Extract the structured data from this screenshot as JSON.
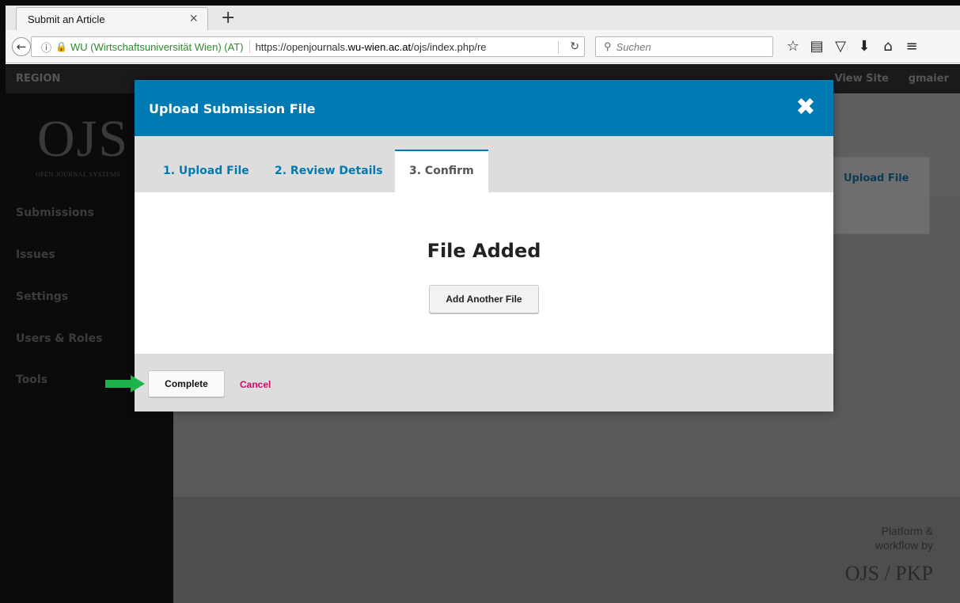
{
  "browser": {
    "tab_title": "Submit an Article",
    "tab_close": "×",
    "new_tab": "+",
    "url_info_icon": "info-icon",
    "url_org": "WU (Wirtschaftsuniversität Wien) (AT)",
    "url_prefix": "https://openjournals.",
    "url_domain": "wu-wien.ac.at",
    "url_suffix": "/ojs/index.php/re",
    "search_placeholder": "Suchen"
  },
  "page": {
    "header_left": "REGION",
    "header_site": "View Site",
    "header_user": "gmaier",
    "logo": "OJS",
    "logo_sub": "OPEN JOURNAL SYSTEMS",
    "sidebar": [
      {
        "label": "Submissions"
      },
      {
        "label": "Issues"
      },
      {
        "label": "Settings"
      },
      {
        "label": "Users & Roles"
      },
      {
        "label": "Tools"
      }
    ],
    "bg_upload_link": "Upload File",
    "footer_line1": "Platform &",
    "footer_line2": "workflow by",
    "footer_logo": "OJS / PKP"
  },
  "modal": {
    "title": "Upload Submission File",
    "tabs": [
      {
        "label": "1. Upload File"
      },
      {
        "label": "2. Review Details"
      },
      {
        "label": "3. Confirm"
      }
    ],
    "active_tab": "3. Confirm",
    "heading": "File Added",
    "add_another_label": "Add Another File",
    "complete_label": "Complete",
    "cancel_label": "Cancel"
  },
  "colors": {
    "accent": "#007ab2",
    "cancel": "#d00a6c",
    "arrow": "#1db34a"
  }
}
